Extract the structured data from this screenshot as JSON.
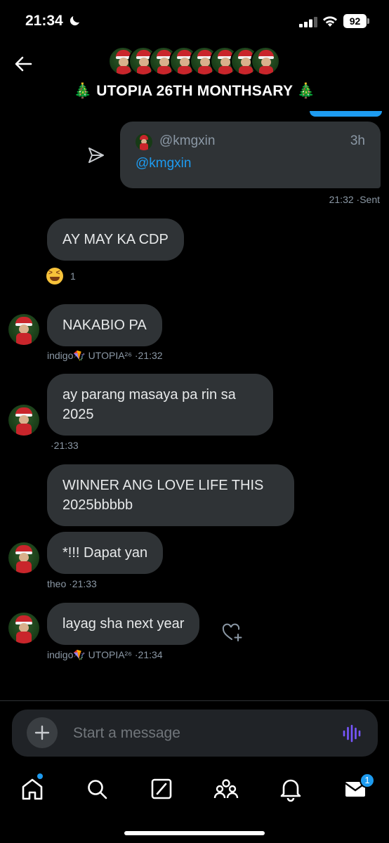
{
  "status_bar": {
    "time": "21:34",
    "battery": "92"
  },
  "header": {
    "title": "🎄 UTOPIA 26TH MONTHSARY 🎄"
  },
  "quote": {
    "handle": "@kmgxin",
    "time": "3h",
    "text": "@kmgxin",
    "meta": "21:32 ·Sent"
  },
  "messages": [
    {
      "text": "AY MAY KA CDP",
      "reaction_count": "1"
    },
    {
      "text": "NAKABIO PA",
      "meta": "indigo🪁 UTOPIA²⁶ ·21:32"
    },
    {
      "text": "ay parang masaya pa rin sa 2025",
      "meta": "·21:33"
    },
    {
      "text": "WINNER ANG LOVE LIFE THIS 2025bbbbb"
    },
    {
      "text": "*!!! Dapat yan",
      "meta": "theo ·21:33"
    },
    {
      "text": "layag sha next year",
      "meta": "indigo🪁 UTOPIA²⁶ ·21:34"
    }
  ],
  "composer": {
    "placeholder": "Start a message"
  },
  "nav": {
    "messages_badge": "1"
  },
  "colors": {
    "accent": "#1d9bf0",
    "bubble": "#2f3336",
    "background": "#000000",
    "voice": "#7856ff"
  }
}
